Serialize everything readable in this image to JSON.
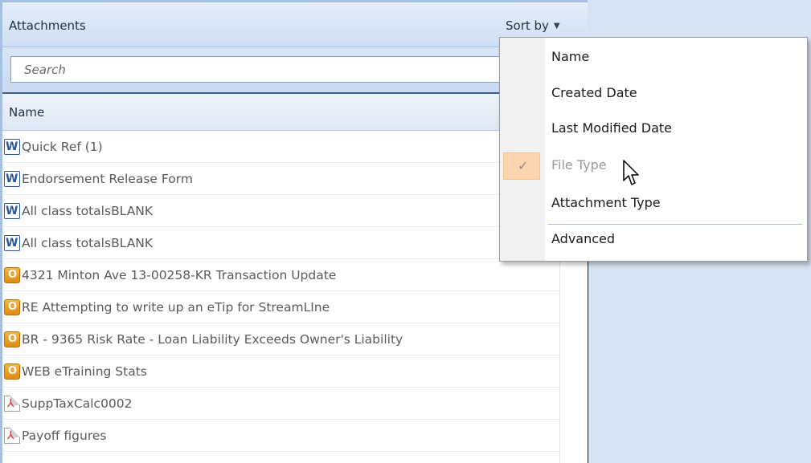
{
  "panel": {
    "title": "Attachments",
    "sort_label": "Sort by",
    "sort_caret_icon": "caret-down-icon"
  },
  "search": {
    "placeholder": "Search",
    "value": ""
  },
  "list": {
    "column_header": "Name",
    "items": [
      {
        "icon": "word-icon",
        "label": "Quick Ref (1)"
      },
      {
        "icon": "word-icon",
        "label": "Endorsement Release Form"
      },
      {
        "icon": "word-icon",
        "label": "All class totalsBLANK"
      },
      {
        "icon": "word-icon",
        "label": "All class totalsBLANK"
      },
      {
        "icon": "outlook-icon",
        "label": "4321 Minton Ave 13-00258-KR Transaction Update"
      },
      {
        "icon": "outlook-icon",
        "label": "RE  Attempting to write up an eTip for StreamLIne"
      },
      {
        "icon": "outlook-icon",
        "label": "BR - 9365 Risk Rate - Loan Liability Exceeds Owner's Liability"
      },
      {
        "icon": "outlook-icon",
        "label": "WEB eTraining  Stats"
      },
      {
        "icon": "pdf-icon",
        "label": "SuppTaxCalc0002"
      },
      {
        "icon": "pdf-icon",
        "label": "Payoff figures"
      }
    ]
  },
  "sort_menu": {
    "items": [
      {
        "label": "Name",
        "checked": false,
        "disabled": false
      },
      {
        "label": "Created Date",
        "checked": false,
        "disabled": false
      },
      {
        "label": "Last Modified Date",
        "checked": false,
        "disabled": false
      },
      {
        "label": "File Type",
        "checked": true,
        "disabled": true
      },
      {
        "label": "Attachment Type",
        "checked": false,
        "disabled": false
      },
      {
        "label": "Advanced",
        "checked": false,
        "disabled": false
      }
    ],
    "check_glyph": "✓",
    "highlight_color": "#fcd5ae"
  },
  "colors": {
    "header_bg": "#d6e3f3",
    "border_accent": "#a7c0e0",
    "word_blue": "#2b579a",
    "outlook_orange": "#e08a12",
    "pdf_red": "#d0312d"
  }
}
